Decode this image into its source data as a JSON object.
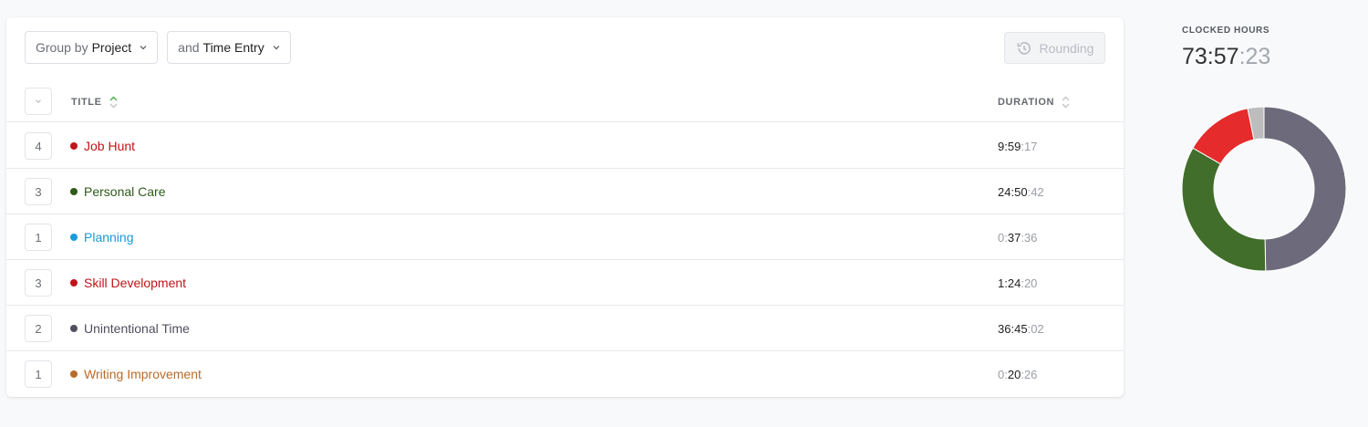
{
  "toolbar": {
    "group_prefix": "Group by",
    "group_value": "Project",
    "then_prefix": "and",
    "then_value": "Time Entry",
    "rounding_label": "Rounding"
  },
  "table": {
    "columns": {
      "title": "TITLE",
      "duration": "DURATION"
    },
    "rows": [
      {
        "count": "4",
        "title": "Job Hunt",
        "color": "#c0141a",
        "dur_h": "9",
        "dur_m": "59",
        "dur_s": "17"
      },
      {
        "count": "3",
        "title": "Personal Care",
        "color": "#2f5a1c",
        "dur_h": "24",
        "dur_m": "50",
        "dur_s": "42"
      },
      {
        "count": "1",
        "title": "Planning",
        "color": "#1a9ad8",
        "dur_h": "0",
        "dur_m": "37",
        "dur_s": "36"
      },
      {
        "count": "3",
        "title": "Skill Development",
        "color": "#c0141a",
        "dur_h": "1",
        "dur_m": "24",
        "dur_s": "20"
      },
      {
        "count": "2",
        "title": "Unintentional Time",
        "color": "#4f4f5f",
        "dur_h": "36",
        "dur_m": "45",
        "dur_s": "02"
      },
      {
        "count": "1",
        "title": "Writing Improvement",
        "color": "#b86c2b",
        "dur_h": "0",
        "dur_m": "20",
        "dur_s": "26"
      }
    ]
  },
  "summary": {
    "label": "CLOCKED HOURS",
    "total_hm": "73:57",
    "total_s": ":23"
  },
  "chart_data": {
    "type": "pie",
    "series": [
      {
        "value": 36.75,
        "color": "#6d6b7b"
      },
      {
        "value": 24.85,
        "color": "#416e2b"
      },
      {
        "value": 9.99,
        "color": "#e52b2b"
      },
      {
        "value": 2.37,
        "color": "#bdbdbd"
      }
    ]
  },
  "colors": {
    "accent_green": "#4caf50",
    "text_muted": "#9a9ea4"
  }
}
